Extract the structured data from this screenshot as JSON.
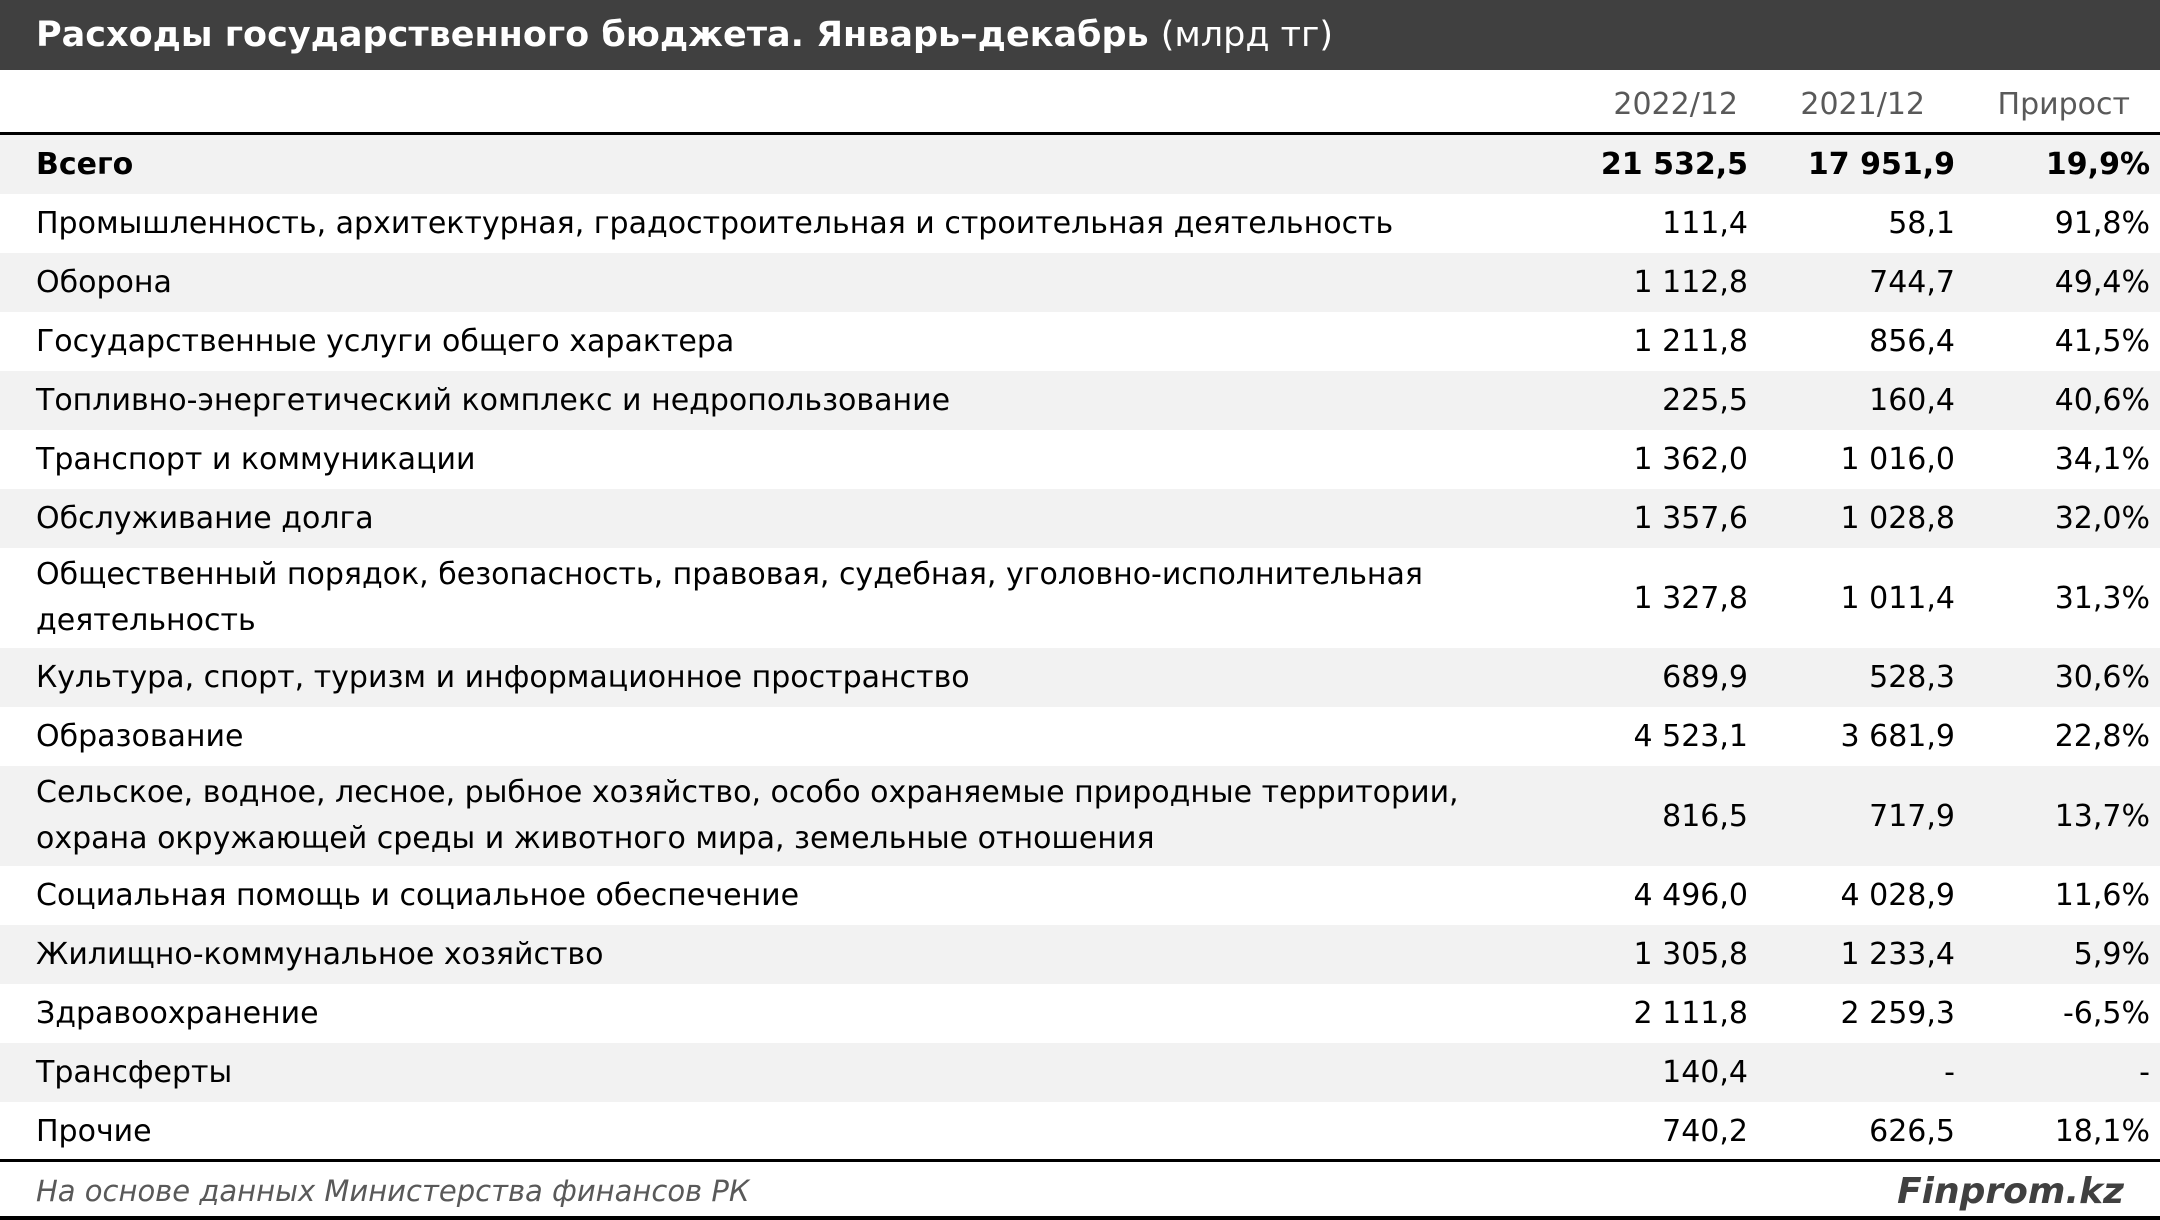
{
  "title": {
    "main": "Расходы государственного бюджета. Январь–декабрь",
    "unit": "(млрд тг)"
  },
  "columns": [
    "2022/12",
    "2021/12",
    "Прирост"
  ],
  "rows": [
    {
      "label": "Всего",
      "v2022": "21 532,5",
      "v2021": "17 951,9",
      "growth": "19,9%"
    },
    {
      "label": "Промышленность, архитектурная, градостроительная и строительная деятельность",
      "v2022": "111,4",
      "v2021": "58,1",
      "growth": "91,8%"
    },
    {
      "label": "Оборона",
      "v2022": "1 112,8",
      "v2021": "744,7",
      "growth": "49,4%"
    },
    {
      "label": "Государственные услуги общего характера",
      "v2022": "1 211,8",
      "v2021": "856,4",
      "growth": "41,5%"
    },
    {
      "label": "Топливно-энергетический комплекс и недропользование",
      "v2022": "225,5",
      "v2021": "160,4",
      "growth": "40,6%"
    },
    {
      "label": "Транспорт и коммуникации",
      "v2022": "1 362,0",
      "v2021": "1 016,0",
      "growth": "34,1%"
    },
    {
      "label": "Обслуживание долга",
      "v2022": "1 357,6",
      "v2021": "1 028,8",
      "growth": "32,0%"
    },
    {
      "label": "Общественный порядок, безопасность, правовая, судебная, уголовно-исполнительная деятельность",
      "v2022": "1 327,8",
      "v2021": "1 011,4",
      "growth": "31,3%"
    },
    {
      "label": "Культура, спорт, туризм и информационное пространство",
      "v2022": "689,9",
      "v2021": "528,3",
      "growth": "30,6%"
    },
    {
      "label": "Образование",
      "v2022": "4 523,1",
      "v2021": "3 681,9",
      "growth": "22,8%"
    },
    {
      "label": "Сельское, водное, лесное, рыбное хозяйство, особо охраняемые природные территории, охрана окружающей среды и животного мира, земельные отношения",
      "v2022": "816,5",
      "v2021": "717,9",
      "growth": "13,7%"
    },
    {
      "label": "Социальная помощь и социальное обеспечение",
      "v2022": "4 496,0",
      "v2021": "4 028,9",
      "growth": "11,6%"
    },
    {
      "label": "Жилищно-коммунальное хозяйство",
      "v2022": "1 305,8",
      "v2021": "1 233,4",
      "growth": "5,9%"
    },
    {
      "label": "Здравоохранение",
      "v2022": "2 111,8",
      "v2021": "2 259,3",
      "growth": "-6,5%"
    },
    {
      "label": "Трансферты",
      "v2022": "140,4",
      "v2021": "-",
      "growth": "-"
    },
    {
      "label": "Прочие",
      "v2022": "740,2",
      "v2021": "626,5",
      "growth": "18,1%"
    }
  ],
  "footer": {
    "source": "На основе данных Министерства финансов РК",
    "brand": "Finprom.kz"
  },
  "colors": {
    "title_bg": "#404040",
    "stripe": "#f2f2f2",
    "header_text": "#595959"
  }
}
